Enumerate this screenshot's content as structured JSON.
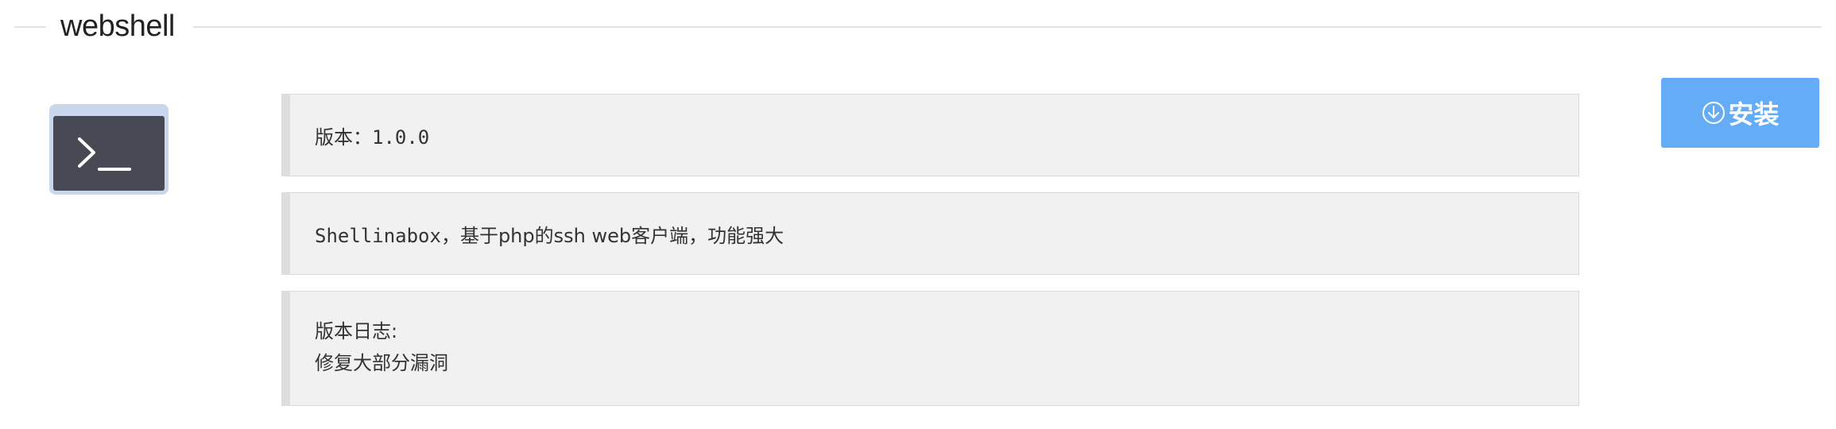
{
  "section": {
    "title": "webshell"
  },
  "app": {
    "icon": "terminal-icon",
    "version_label": "版本：",
    "version_value": "1.0.0",
    "description_prefix": "Shellinabox，",
    "description_rest": "基于php的ssh web客户端，功能强大",
    "changelog_label": "版本日志:",
    "changelog_text": "修复大部分漏洞"
  },
  "actions": {
    "install_label": "安装",
    "install_icon": "download-circle-icon"
  },
  "colors": {
    "accent": "#64adf6",
    "card_bg": "#f1f1f1",
    "card_border": "#dedede",
    "icon_bg": "#c9d6ec",
    "terminal_bg": "#474955"
  }
}
